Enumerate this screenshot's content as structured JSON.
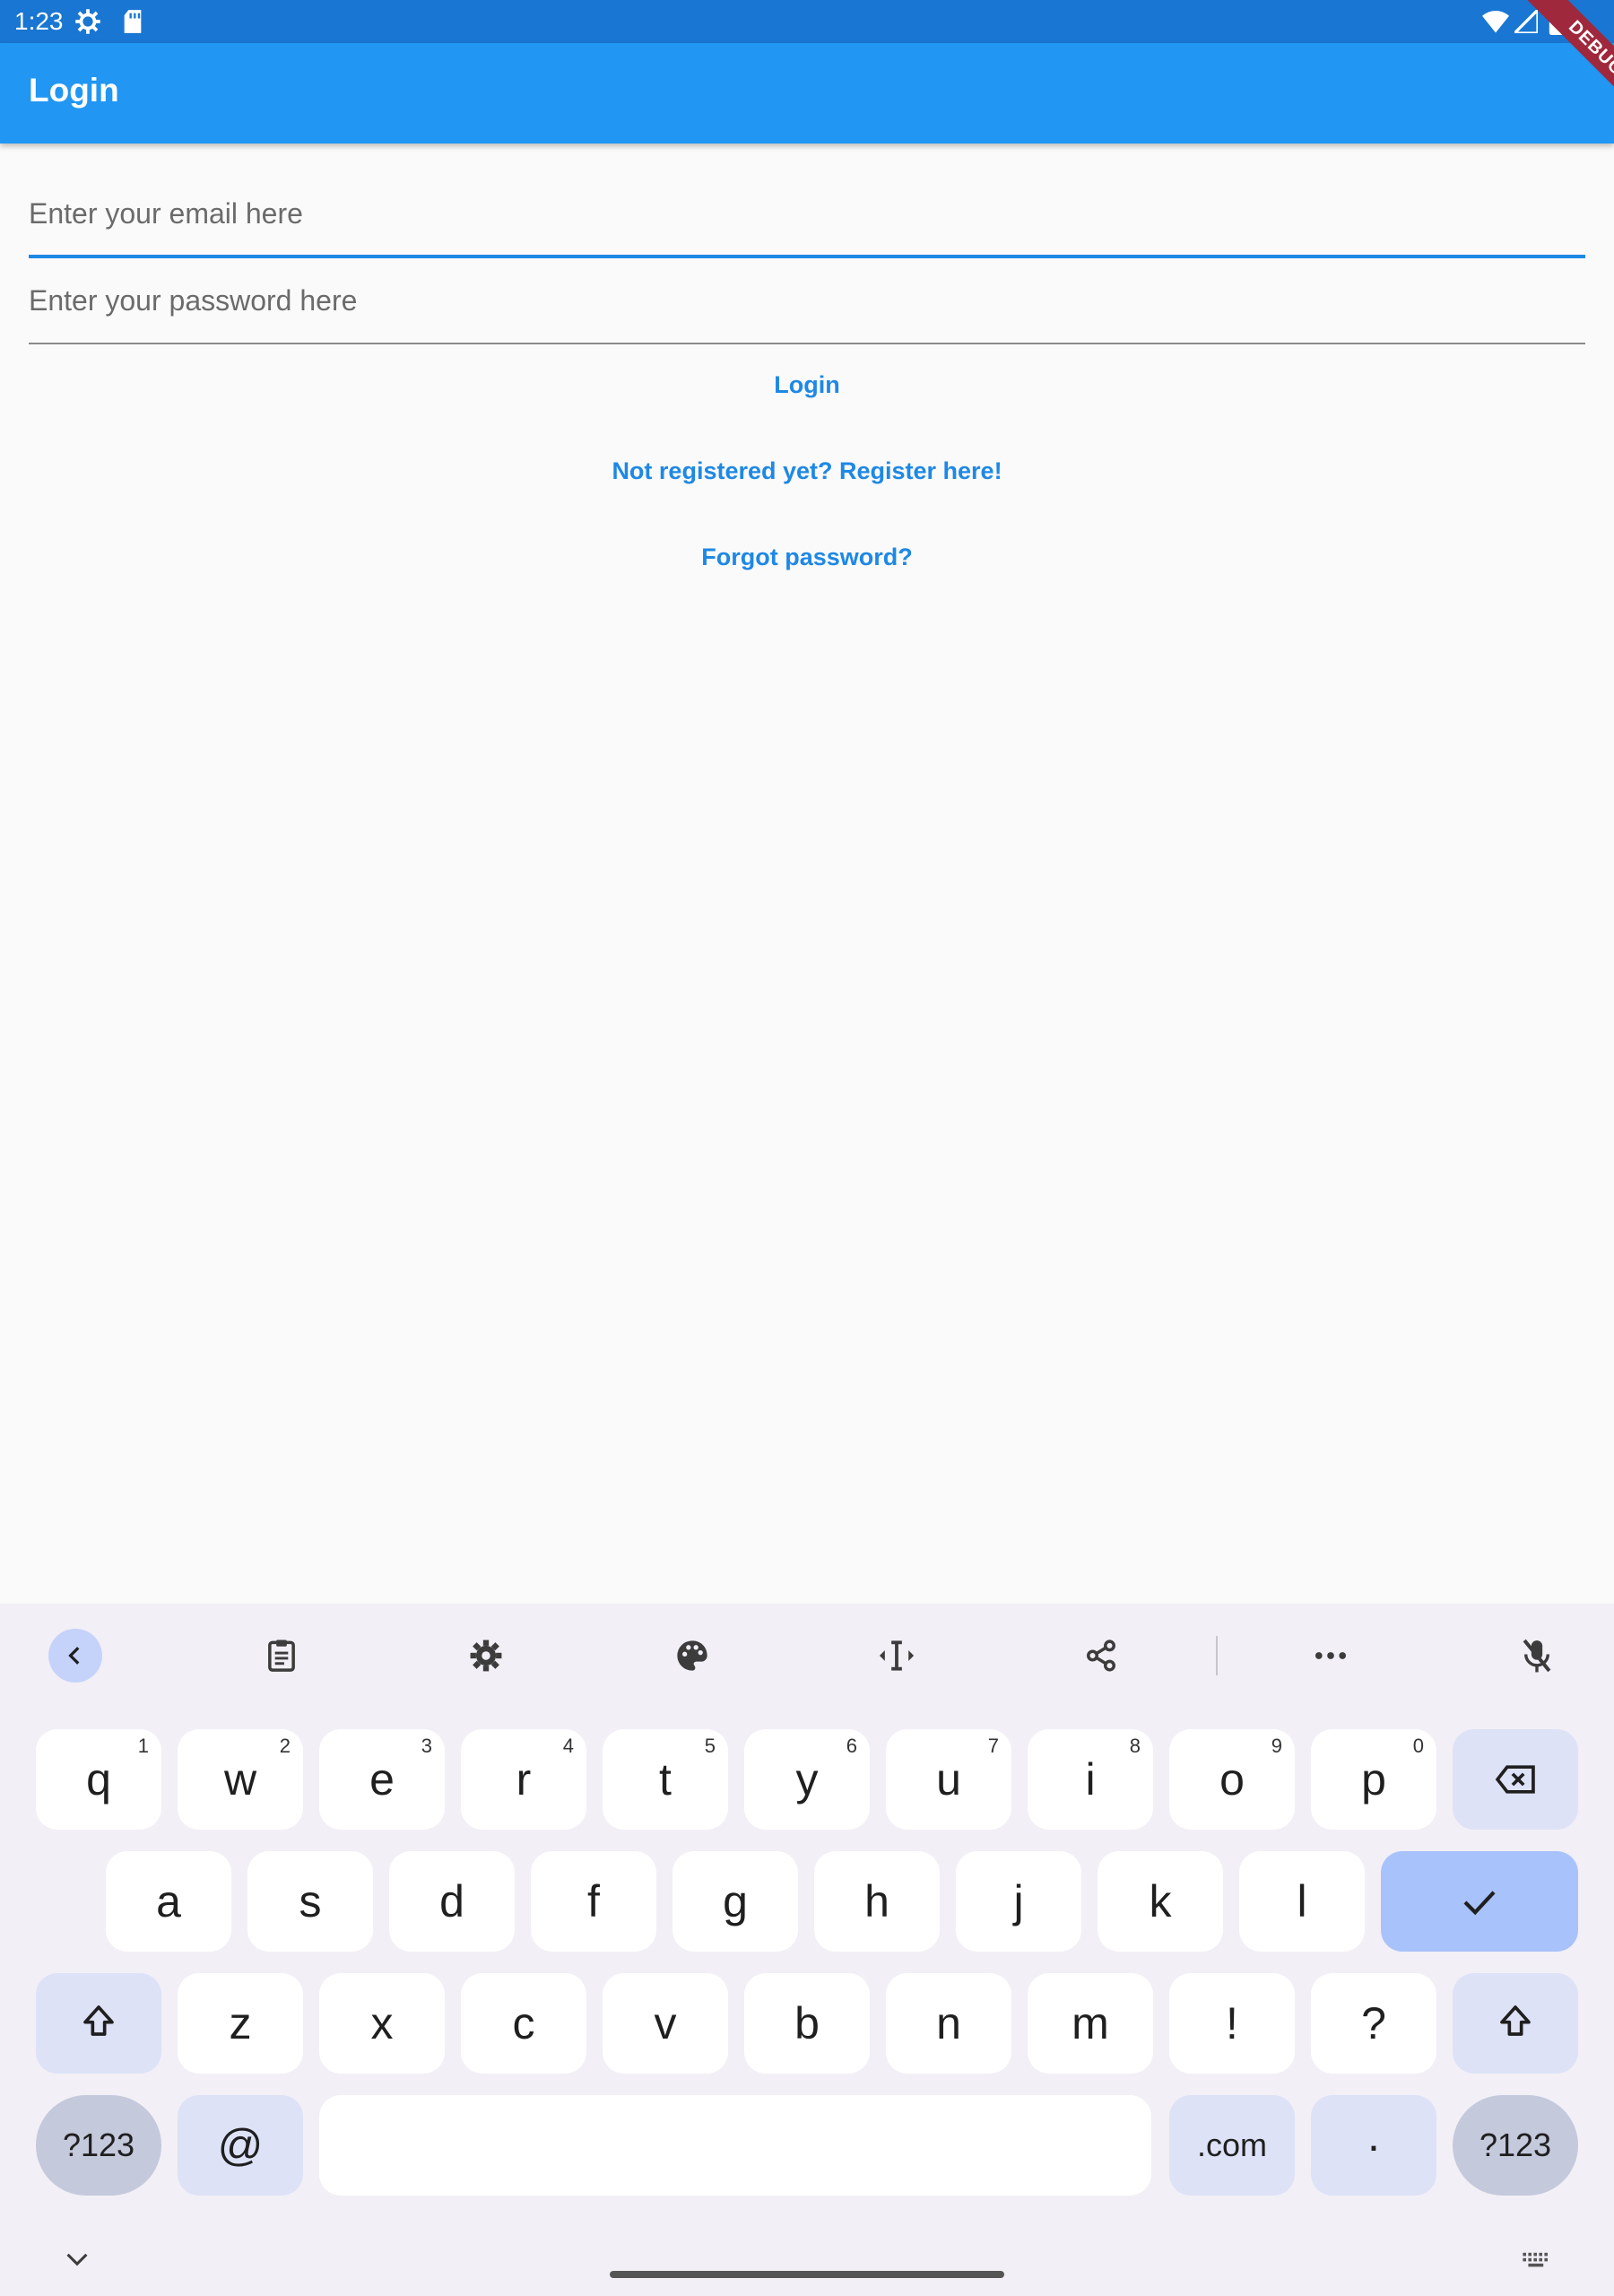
{
  "status_bar": {
    "time": "1:23"
  },
  "debug_banner": "DEBUG",
  "app_bar": {
    "title": "Login"
  },
  "form": {
    "email_placeholder": "Enter your email here",
    "password_placeholder": "Enter your password here",
    "login_label": "Login",
    "register_label": "Not registered yet? Register here!",
    "forgot_label": "Forgot password?"
  },
  "keyboard": {
    "row1": [
      {
        "key": "q",
        "hint": "1"
      },
      {
        "key": "w",
        "hint": "2"
      },
      {
        "key": "e",
        "hint": "3"
      },
      {
        "key": "r",
        "hint": "4"
      },
      {
        "key": "t",
        "hint": "5"
      },
      {
        "key": "y",
        "hint": "6"
      },
      {
        "key": "u",
        "hint": "7"
      },
      {
        "key": "i",
        "hint": "8"
      },
      {
        "key": "o",
        "hint": "9"
      },
      {
        "key": "p",
        "hint": "0"
      }
    ],
    "row2": [
      "a",
      "s",
      "d",
      "f",
      "g",
      "h",
      "j",
      "k",
      "l"
    ],
    "row3": [
      "z",
      "x",
      "c",
      "v",
      "b",
      "n",
      "m",
      "!",
      "?"
    ],
    "symbols_left": "?123",
    "at": "@",
    "dotcom": ".com",
    "period": "·",
    "symbols_right": "?123"
  },
  "colors": {
    "status_bar": "#1976d2",
    "app_bar": "#2196f3",
    "accent": "#1e88e5",
    "keyboard_bg": "#f2eff6"
  }
}
